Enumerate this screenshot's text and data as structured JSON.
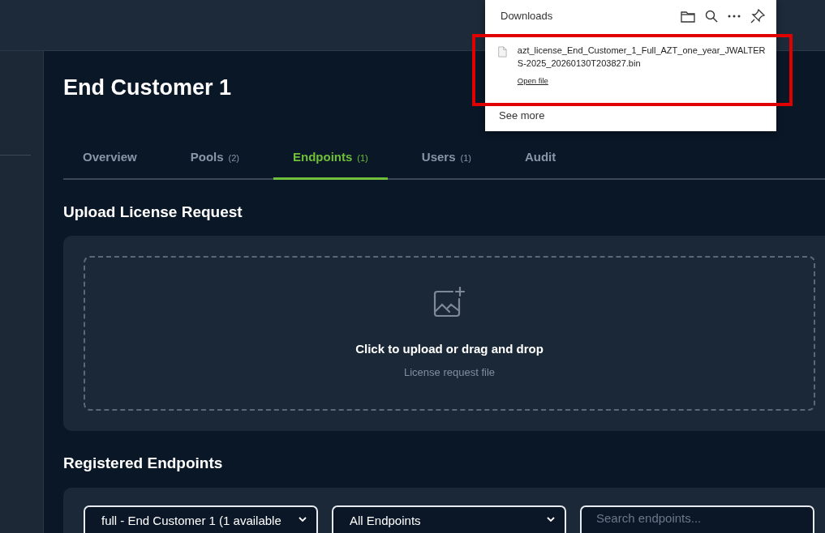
{
  "page": {
    "title": "End Customer 1"
  },
  "tabs": [
    {
      "label": "Overview",
      "selected": false
    },
    {
      "label": "Pools",
      "count": "(2)",
      "selected": false
    },
    {
      "label": "Endpoints",
      "count": "(1)",
      "selected": true
    },
    {
      "label": "Users",
      "count": "(1)",
      "selected": false
    },
    {
      "label": "Audit",
      "selected": false
    }
  ],
  "upload": {
    "heading": "Upload License Request",
    "prompt": "Click to upload or drag and drop",
    "hint": "License request file"
  },
  "endpoints": {
    "heading": "Registered Endpoints",
    "filters": [
      {
        "kind": "select",
        "value": "full - End Customer 1 (1 available"
      },
      {
        "kind": "select",
        "value": "All Endpoints"
      },
      {
        "kind": "search",
        "placeholder": "Search endpoints..."
      }
    ]
  },
  "downloads": {
    "title": "Downloads",
    "file_name": "azt_license_End_Customer_1_Full_AZT_one_year_JWALTERS-2025_20260130T203827.bin",
    "open_link": "Open file",
    "see_more": "See more",
    "highlighted": true
  }
}
